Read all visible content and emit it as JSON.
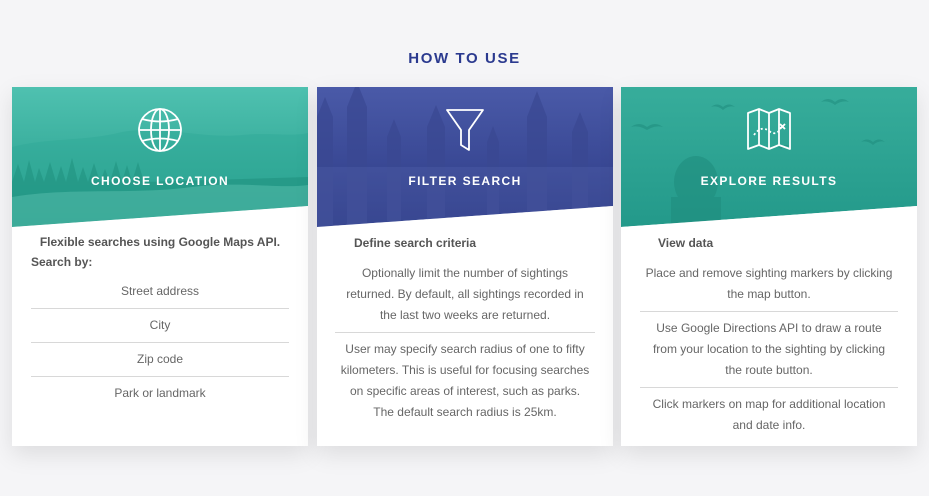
{
  "section_title": "HOW TO USE",
  "colors": {
    "title": "#2b3a8f",
    "teal": "#2ea896",
    "navy": "#33408e"
  },
  "cards": [
    {
      "title": "CHOOSE LOCATION",
      "icon": "globe-icon",
      "intro": "Flexible searches using Google Maps API.",
      "subtitle": "Search by:",
      "items": [
        "Street address",
        "City",
        "Zip code",
        "Park or landmark"
      ]
    },
    {
      "title": "FILTER SEARCH",
      "icon": "funnel-icon",
      "subtitle": "Define search criteria",
      "items": [
        "Optionally limit the number of sightings returned. By default, all sightings recorded in the last two weeks are returned.",
        "User may specify search radius of one to fifty kilometers. This is useful for focusing searches on specific areas of interest, such as parks. The default search radius is 25km."
      ]
    },
    {
      "title": "EXPLORE RESULTS",
      "icon": "treasure-map-icon",
      "subtitle": "View data",
      "items": [
        "Place and remove sighting markers by clicking the map button.",
        "Use Google Directions API to draw a route from your location to the sighting by clicking the route button.",
        "Click markers on map for additional location and date info."
      ]
    }
  ]
}
